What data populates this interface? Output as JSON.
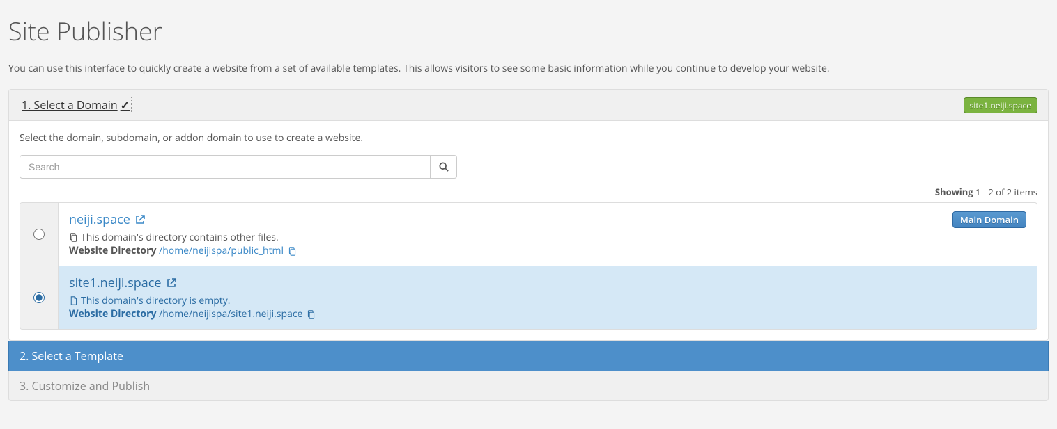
{
  "page": {
    "title": "Site Publisher",
    "intro": "You can use this interface to quickly create a website from a set of available templates. This allows visitors to see some basic information while you continue to develop your website."
  },
  "step1": {
    "title": "1. Select a Domain",
    "selected_domain_badge": "site1.neiji.space",
    "help": "Select the domain, subdomain, or addon domain to use to create a website.",
    "search_placeholder": "Search",
    "showing_label": "Showing",
    "showing_range": " 1 - 2 of 2 items",
    "website_directory_label": "Website Directory",
    "domains": [
      {
        "name": "neiji.space",
        "dir_note": "This domain's directory contains other files.",
        "path": "/home/neijispa/public_html",
        "main_domain_badge": "Main Domain",
        "selected": false
      },
      {
        "name": "site1.neiji.space",
        "dir_note": "This domain's directory is empty.",
        "path": "/home/neijispa/site1.neiji.space",
        "main_domain_badge": "",
        "selected": true
      }
    ]
  },
  "step2": {
    "title": "2. Select a Template"
  },
  "step3": {
    "title": "3. Customize and Publish"
  }
}
